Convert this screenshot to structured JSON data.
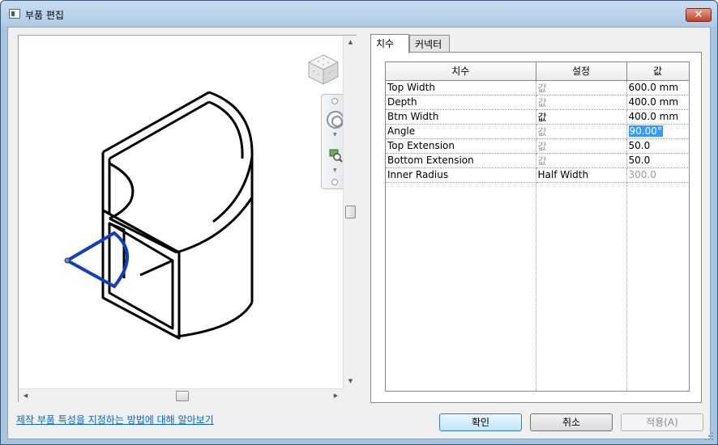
{
  "window": {
    "title": "부품 편집",
    "close_label": "✕"
  },
  "tabs": [
    {
      "label": "치수",
      "active": true
    },
    {
      "label": "커넥터",
      "active": false
    }
  ],
  "grid": {
    "headers": [
      "치수",
      "설정",
      "값"
    ],
    "rows": [
      {
        "name": "Top Width",
        "setting": "값",
        "value": "600.0 mm"
      },
      {
        "name": "Depth",
        "setting": "값",
        "value": "400.0 mm"
      },
      {
        "name": "Btm Width",
        "setting": "값",
        "value": "400.0 mm"
      },
      {
        "name": "Angle",
        "setting": "값",
        "value": "90.00°"
      },
      {
        "name": "Top Extension",
        "setting": "값",
        "value": "50.0"
      },
      {
        "name": "Bottom Extension",
        "setting": "값",
        "value": "50.0"
      },
      {
        "name": "Inner Radius",
        "setting": "Half Width",
        "value": "300.0"
      }
    ]
  },
  "footer": {
    "help_link": "제작 부품 특성을 지정하는 방법에 대해 알아보기",
    "ok_label": "확인",
    "cancel_label": "취소",
    "apply_label": "적용(A)"
  },
  "icons": {
    "close": "close-icon",
    "viewcube": "viewcube-icon",
    "steering_wheel": "steering-wheel-icon",
    "zoom": "zoom-icon"
  },
  "colors": {
    "selection": "#3399ff",
    "link": "#0066cc",
    "angle_arc": "#1040c0"
  }
}
